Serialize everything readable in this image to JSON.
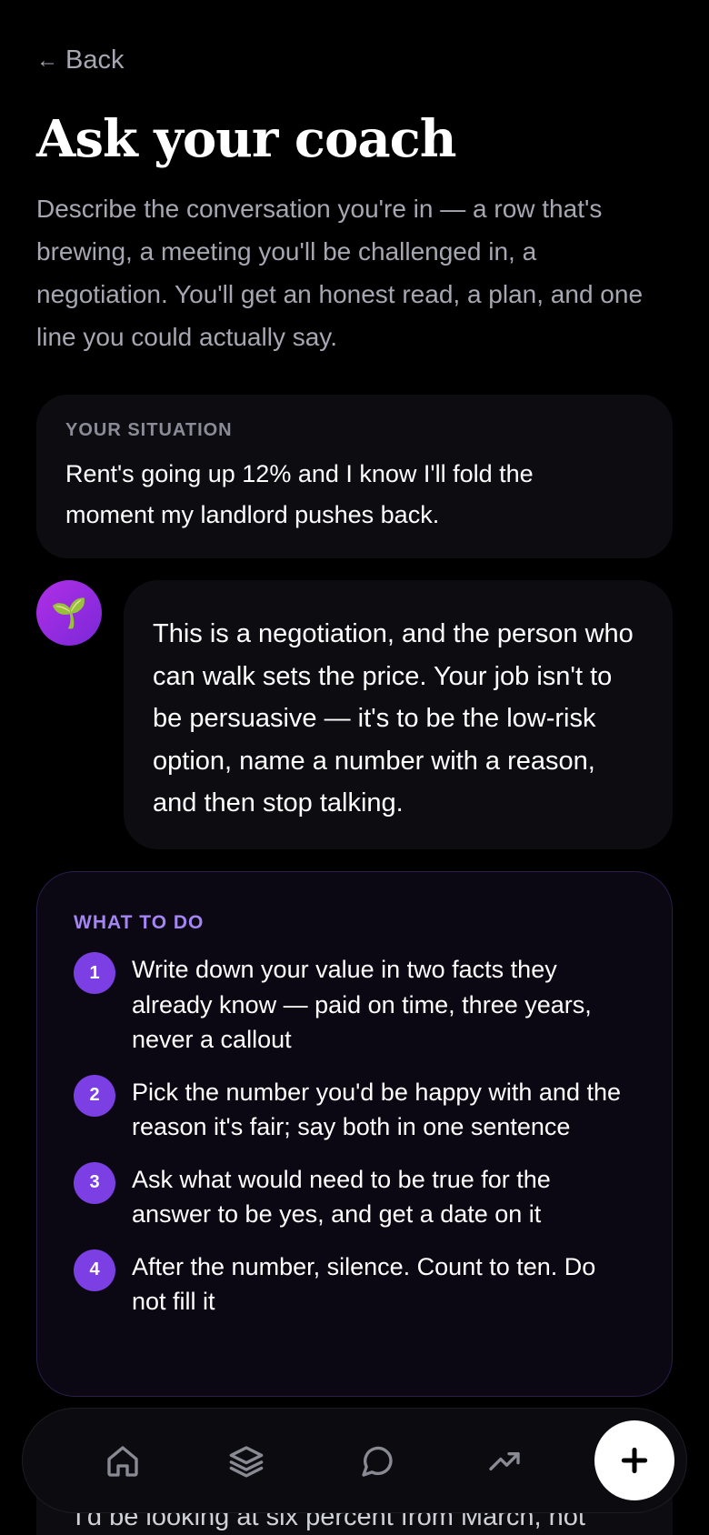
{
  "header": {
    "back_arrow": "←",
    "back_label": "Back",
    "title": "Ask your coach",
    "intro": "Describe the conversation you're in — a row that's brewing, a meeting you'll be challenged in, a negotiation. You'll get an honest read, a plan, and one line you could actually say."
  },
  "situation": {
    "label": "YOUR SITUATION",
    "text": "Rent's going up 12% and I know I'll fold the moment my landlord pushes back."
  },
  "coach": {
    "avatar_icon": "🌱",
    "reply": "This is a negotiation, and the person who can walk sets the price. Your job isn't to be persuasive — it's to be the low-risk option, name a number with a reason, and then stop talking."
  },
  "todo": {
    "label": "WHAT TO DO",
    "steps": [
      {
        "num": "1",
        "text": "Write down your value in two facts they already know — paid on time, three years, never a callout"
      },
      {
        "num": "2",
        "text": "Pick the number you'd be happy with and the reason it's fair; say both in one sentence"
      },
      {
        "num": "3",
        "text": "Ask what would need to be true for the answer to be yes, and get a date on it"
      },
      {
        "num": "4",
        "text": "After the number, silence. Count to ten. Do not fill it"
      }
    ]
  },
  "line_card": {
    "quote": "\"I'd be looking at six percent from March, not"
  },
  "nav": {
    "items": [
      "home-icon",
      "layers-icon",
      "chat-icon",
      "trending-icon"
    ],
    "fab_icon": "plus-icon"
  },
  "colors": {
    "background": "#000000",
    "card": "#0d0d11",
    "accent": "#7b3fe4",
    "accent_label": "#a585f3",
    "muted_text": "#a7a7b3"
  }
}
